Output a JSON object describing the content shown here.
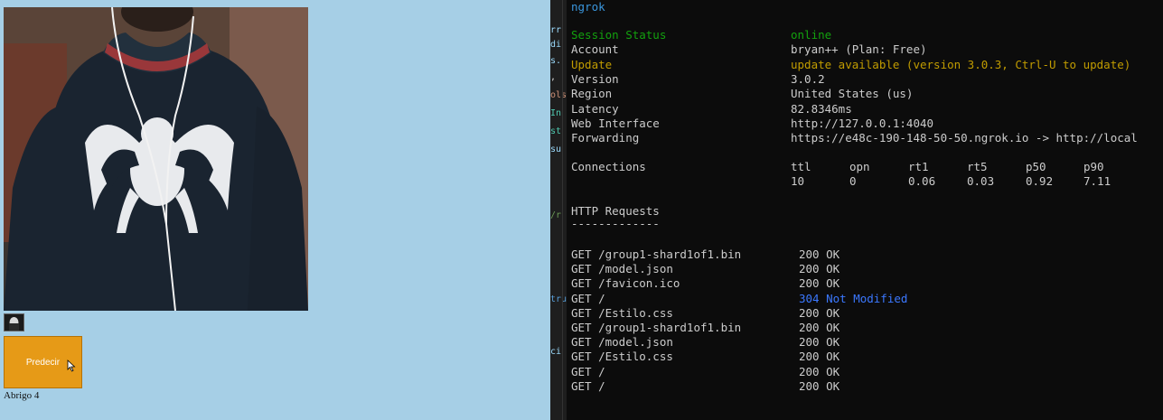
{
  "webpage": {
    "predict_button": "Predecir",
    "prediction_result": "Abrigo 4"
  },
  "editor_fragments": [
    "rr",
    "di",
    "s.",
    ",",
    "ols",
    "In",
    "st",
    "su",
    "/r",
    "tru",
    "ci"
  ],
  "terminal": {
    "title": "ngrok",
    "status_rows": [
      {
        "label": "Session Status",
        "value": "online",
        "color": "#13a10e"
      },
      {
        "label": "Account",
        "value": "bryan++ (Plan: Free)",
        "color": "#cccccc"
      },
      {
        "label": "Update",
        "value": "update available (version 3.0.3, Ctrl-U to update)",
        "color": "#c19c00"
      },
      {
        "label": "Version",
        "value": "3.0.2",
        "color": "#cccccc"
      },
      {
        "label": "Region",
        "value": "United States (us)",
        "color": "#cccccc"
      },
      {
        "label": "Latency",
        "value": "82.8346ms",
        "color": "#cccccc"
      },
      {
        "label": "Web Interface",
        "value": "http://127.0.0.1:4040",
        "color": "#cccccc"
      },
      {
        "label": "Forwarding",
        "value": "https://e48c-190-148-50-50.ngrok.io -> http://local",
        "color": "#cccccc"
      }
    ],
    "connections": {
      "label": "Connections",
      "headers": [
        "ttl",
        "opn",
        "rt1",
        "rt5",
        "p50",
        "p90"
      ],
      "values": [
        "10",
        "0",
        "0.06",
        "0.03",
        "0.92",
        "7.11"
      ]
    },
    "http_requests_title": "HTTP Requests",
    "http_requests_underline": "-------------",
    "requests": [
      {
        "method_path": "GET /group1-shard1of1.bin",
        "status": "200 OK",
        "color": "#cccccc"
      },
      {
        "method_path": "GET /model.json",
        "status": "200 OK",
        "color": "#cccccc"
      },
      {
        "method_path": "GET /favicon.ico",
        "status": "200 OK",
        "color": "#cccccc"
      },
      {
        "method_path": "GET /",
        "status": "304 Not Modified",
        "color": "#3b78ff"
      },
      {
        "method_path": "GET /Estilo.css",
        "status": "200 OK",
        "color": "#cccccc"
      },
      {
        "method_path": "GET /group1-shard1of1.bin",
        "status": "200 OK",
        "color": "#cccccc"
      },
      {
        "method_path": "GET /model.json",
        "status": "200 OK",
        "color": "#cccccc"
      },
      {
        "method_path": "GET /Estilo.css",
        "status": "200 OK",
        "color": "#cccccc"
      },
      {
        "method_path": "GET /",
        "status": "200 OK",
        "color": "#cccccc"
      },
      {
        "method_path": "GET /",
        "status": "200 OK",
        "color": "#cccccc"
      }
    ]
  }
}
